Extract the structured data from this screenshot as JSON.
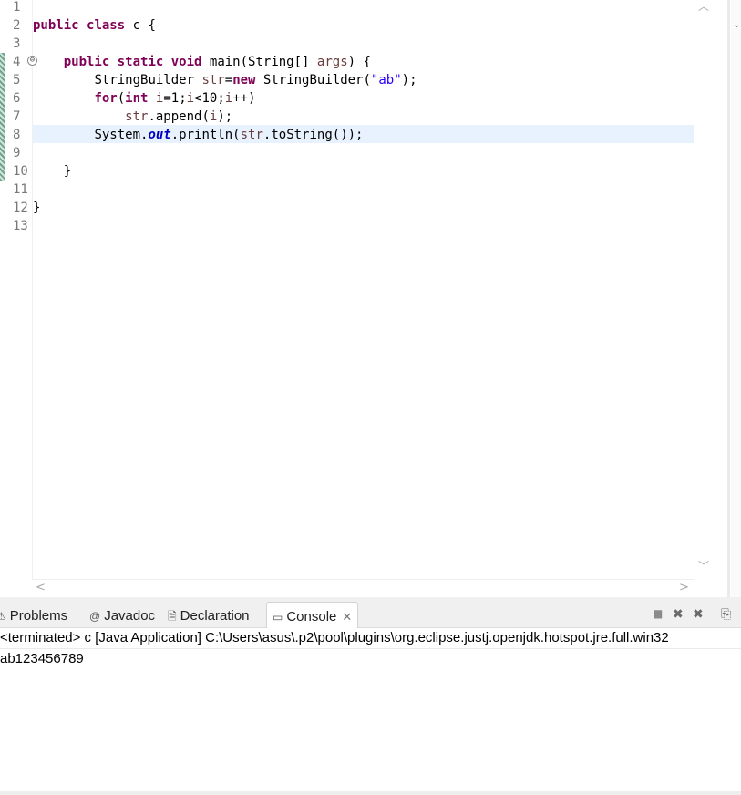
{
  "editor": {
    "line_numbers": [
      "1",
      "2",
      "3",
      "4",
      "5",
      "6",
      "7",
      "8",
      "9",
      "10",
      "11",
      "12",
      "13"
    ],
    "fold_marker": "⊖",
    "code": {
      "l2": {
        "kw1": "public",
        "kw2": "class",
        "rest": " c {"
      },
      "l4": {
        "kw1": "public",
        "kw2": "static",
        "kw3": "void",
        "a": " main(String[] ",
        "args": "args",
        "b": ") {"
      },
      "l5": {
        "a": "StringBuilder ",
        "v": "str",
        "eq": "=",
        "kw": "new",
        "b": " StringBuilder(",
        "s": "\"ab\"",
        "c": ");"
      },
      "l6": {
        "kw1": "for",
        "a": "(",
        "kw2": "int",
        "b": " ",
        "v1": "i",
        "c": "=1;",
        "v2": "i",
        "d": "<10;",
        "v3": "i",
        "e": "++)"
      },
      "l7": {
        "v": "str",
        "a": ".append(",
        "v2": "i",
        "b": ");"
      },
      "l8": {
        "a": "System.",
        "f": "out",
        "b": ".println(",
        "v": "str",
        "c": ".toString());"
      },
      "l10": "}",
      "l12": "}"
    }
  },
  "tabs": [
    {
      "icon": "problems-icon",
      "glyph": "⚠",
      "label": "Problems"
    },
    {
      "icon": "javadoc-icon",
      "glyph": "@",
      "label": "Javadoc"
    },
    {
      "icon": "declaration-icon",
      "glyph": "🗎",
      "label": "Declaration"
    },
    {
      "icon": "console-icon",
      "glyph": "▭",
      "label": "Console",
      "close": "✕"
    }
  ],
  "toolbar": {
    "stop": "■",
    "remove": "✖",
    "remove_all": "✖",
    "other": "⎘"
  },
  "console": {
    "header": "<terminated> c [Java Application] C:\\Users\\asus\\.p2\\pool\\plugins\\org.eclipse.justj.openjdk.hotspot.jre.full.win32",
    "output": "ab123456789"
  }
}
